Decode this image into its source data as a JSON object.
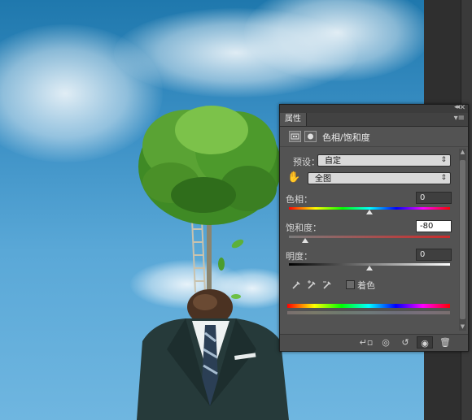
{
  "panel": {
    "tab_label": "属性",
    "collapse_glyph": "◂◂",
    "close_glyph": "✕",
    "menu_glyph": "▾≡",
    "adjustment_title": "色相/饱和度",
    "preset_label": "预设：",
    "preset_value": "自定",
    "channel_value": "全图",
    "hue_label": "色相：",
    "hue_value": "0",
    "hue_level": 0.5,
    "saturation_label": "饱和度：",
    "saturation_value": "-80",
    "saturation_level": 0.1,
    "lightness_label": "明度：",
    "lightness_value": "0",
    "lightness_level": 0.5,
    "colorize_label": "着色",
    "colorize_checked": false
  },
  "icons": {
    "hand_tool": "hand-icon",
    "eyedroppers": [
      "eyedropper-icon",
      "eyedropper-plus-icon",
      "eyedropper-minus-icon"
    ],
    "bottom": [
      "clip-to-layer-icon",
      "view-previous-icon",
      "reset-icon",
      "visibility-eye-icon",
      "delete-icon"
    ]
  },
  "colors": {
    "panel_bg": "#535353",
    "panel_dark": "#3c3c3c",
    "sky_top": "#1f78ad",
    "sky_bottom": "#6fb6e0"
  }
}
